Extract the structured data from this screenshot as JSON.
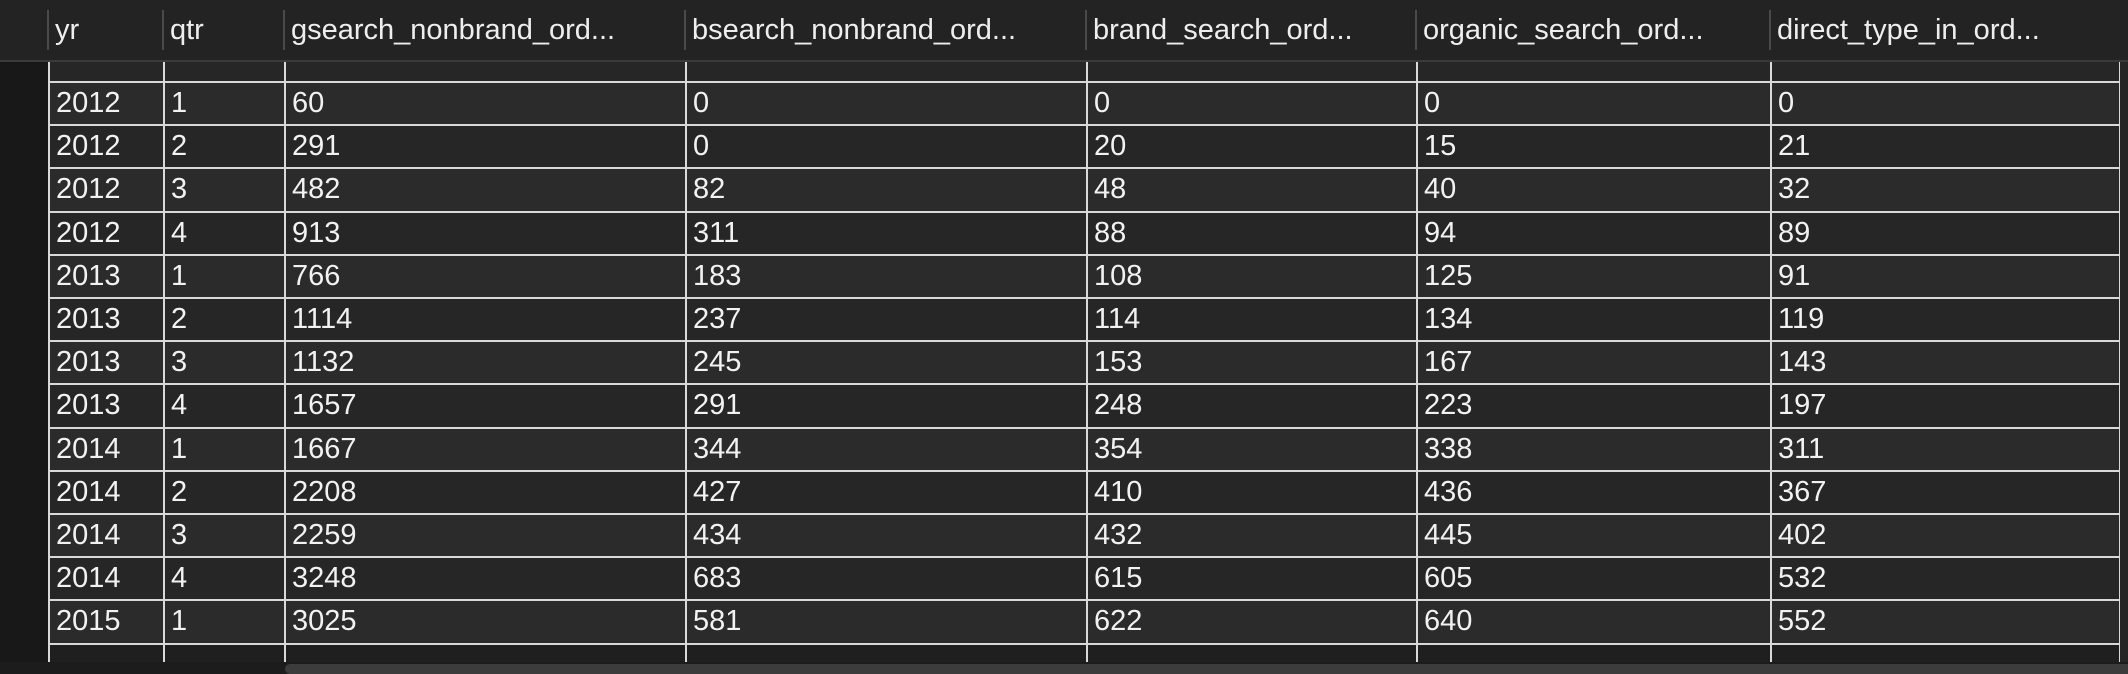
{
  "columns": [
    "yr",
    "qtr",
    "gsearch_nonbrand_ord...",
    "bsearch_nonbrand_ord...",
    "brand_search_ord...",
    "organic_search_ord...",
    "direct_type_in_ord..."
  ],
  "rows": [
    [
      "2012",
      "1",
      "60",
      "0",
      "0",
      "0",
      "0"
    ],
    [
      "2012",
      "2",
      "291",
      "0",
      "20",
      "15",
      "21"
    ],
    [
      "2012",
      "3",
      "482",
      "82",
      "48",
      "40",
      "32"
    ],
    [
      "2012",
      "4",
      "913",
      "311",
      "88",
      "94",
      "89"
    ],
    [
      "2013",
      "1",
      "766",
      "183",
      "108",
      "125",
      "91"
    ],
    [
      "2013",
      "2",
      "1114",
      "237",
      "114",
      "134",
      "119"
    ],
    [
      "2013",
      "3",
      "1132",
      "245",
      "153",
      "167",
      "143"
    ],
    [
      "2013",
      "4",
      "1657",
      "291",
      "248",
      "223",
      "197"
    ],
    [
      "2014",
      "1",
      "1667",
      "344",
      "354",
      "338",
      "311"
    ],
    [
      "2014",
      "2",
      "2208",
      "427",
      "410",
      "436",
      "367"
    ],
    [
      "2014",
      "3",
      "2259",
      "434",
      "432",
      "445",
      "402"
    ],
    [
      "2014",
      "4",
      "3248",
      "683",
      "615",
      "605",
      "532"
    ],
    [
      "2015",
      "1",
      "3025",
      "581",
      "622",
      "640",
      "552"
    ]
  ]
}
